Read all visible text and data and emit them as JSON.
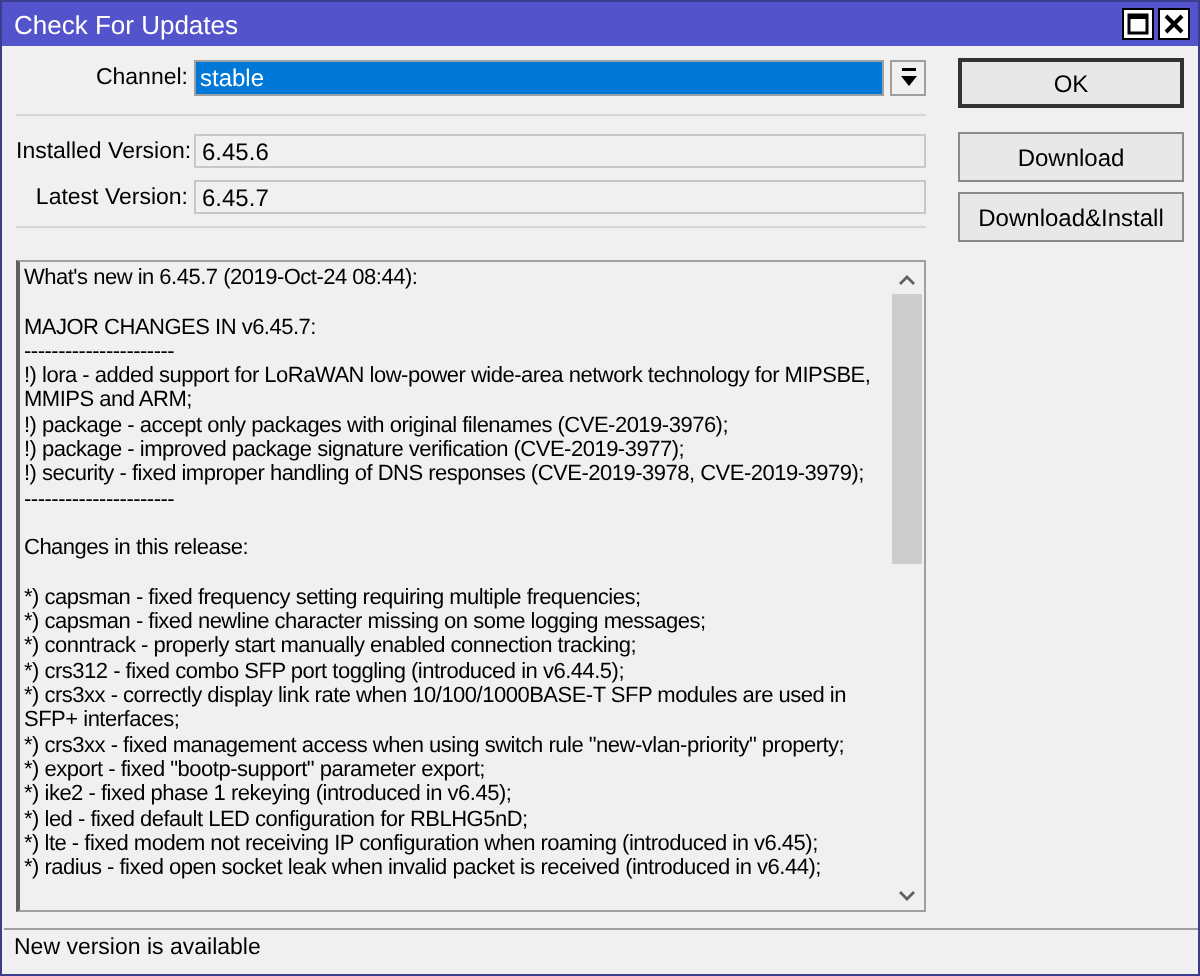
{
  "window": {
    "title": "Check For Updates"
  },
  "channel": {
    "label": "Channel:",
    "value": "stable",
    "selected": true
  },
  "fields": [
    {
      "label": "Installed Version:",
      "value": "6.45.6"
    },
    {
      "label": "Latest Version:",
      "value": "6.45.7"
    }
  ],
  "buttons": [
    {
      "label": "OK",
      "default": true
    },
    {
      "label": "Download",
      "default": false
    },
    {
      "label": "Download&Install",
      "default": false
    }
  ],
  "changelog": [
    [
      "What's new in 6.45.7 (2019-Oct-24 08:44):"
    ],
    [
      "MAJOR CHANGES IN v6.45.7:",
      "----------------------",
      "!) lora - added support for LoRaWAN low-power wide-area network technology for MIPSBE,",
      "MMIPS and ARM;",
      "!) package - accept only packages with original filenames (CVE-2019-3976);",
      "!) package - improved package signature verification (CVE-2019-3977);",
      "!) security - fixed improper handling of DNS responses (CVE-2019-3978, CVE-2019-3979);",
      "----------------------"
    ],
    [
      "Changes in this release:"
    ],
    [
      "*) capsman - fixed frequency setting requiring multiple frequencies;",
      "*) capsman - fixed newline character missing on some logging messages;",
      "*) conntrack - properly start manually enabled connection tracking;",
      "*) crs312 - fixed combo SFP port toggling (introduced in v6.44.5);",
      "*) crs3xx - correctly display link rate when 10/100/1000BASE-T SFP modules are used in",
      "SFP+ interfaces;",
      "*) crs3xx - fixed management access when using switch rule \"new-vlan-priority\" property;",
      "*) export - fixed \"bootp-support\" parameter export;",
      "*) ike2 - fixed phase 1 rekeying (introduced in v6.45);",
      "*) led - fixed default LED configuration for RBLHG5nD;",
      "*) lte - fixed modem not receiving IP configuration when roaming (introduced in v6.45);",
      "*) radius - fixed open socket leak when invalid packet is received (introduced in v6.44);"
    ]
  ],
  "status_bar": "New version is available"
}
